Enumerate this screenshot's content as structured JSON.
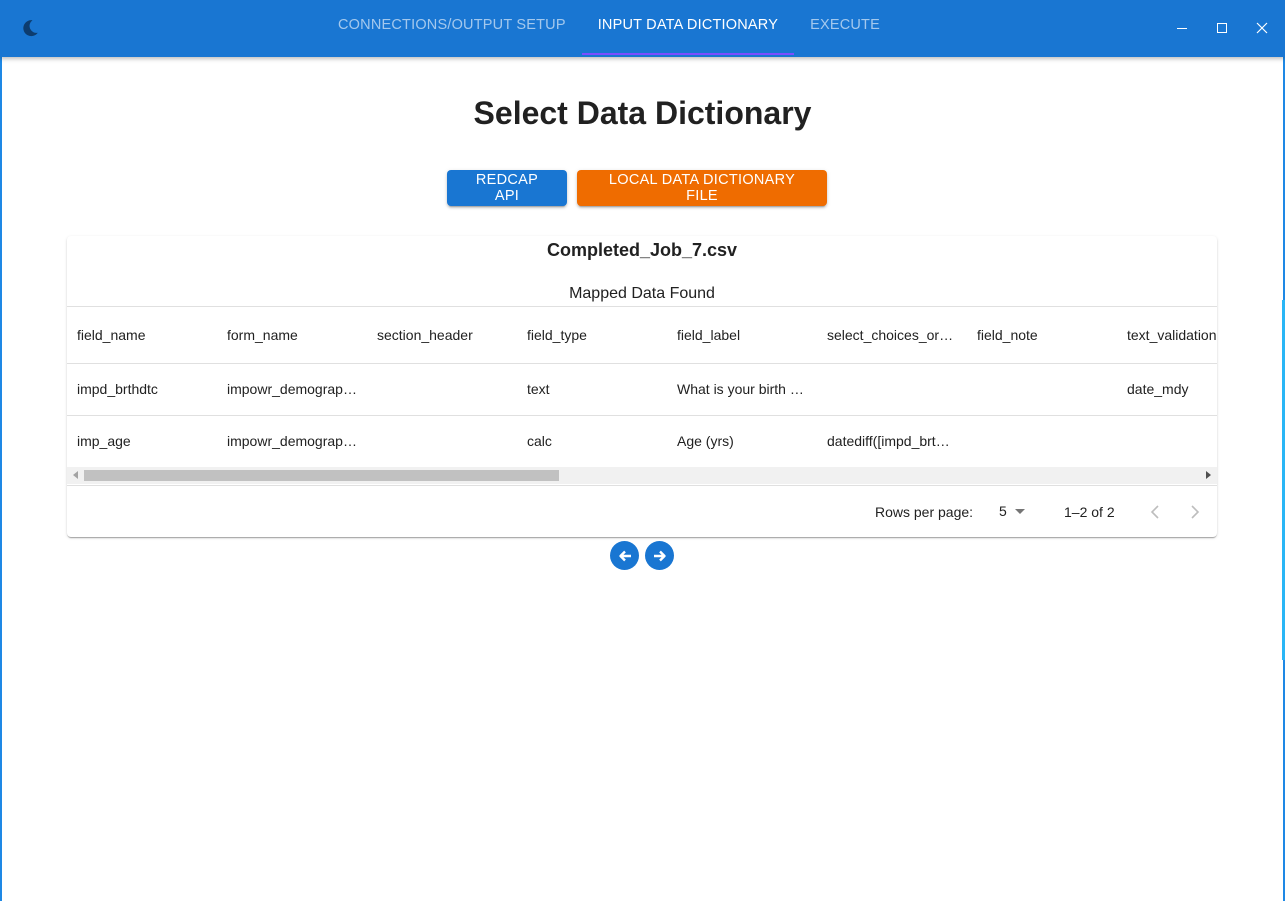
{
  "appbar": {
    "theme_icon": "moon-icon",
    "tabs": [
      {
        "label": "CONNECTIONS/OUTPUT SETUP",
        "active": false
      },
      {
        "label": "INPUT DATA DICTIONARY",
        "active": true
      },
      {
        "label": "EXECUTE",
        "active": false
      }
    ],
    "window_controls": [
      "minimize-icon",
      "maximize-icon",
      "close-icon"
    ]
  },
  "main": {
    "title": "Select Data Dictionary",
    "buttons": {
      "redcap": "REDCAP API",
      "local": "LOCAL DATA DICTIONARY FILE"
    }
  },
  "card": {
    "filename": "Completed_Job_7.csv",
    "subtitle": "Mapped Data Found",
    "columns": [
      "field_name",
      "form_name",
      "section_header",
      "field_type",
      "field_label",
      "select_choices_or_calculations",
      "field_note",
      "text_validation"
    ],
    "rows": [
      [
        "impd_brthdtc",
        "impowr_demographics",
        "",
        "text",
        "What is your birth date?",
        "",
        "",
        "date_mdy"
      ],
      [
        "imp_age",
        "impowr_demographics",
        "",
        "calc",
        "Age (yrs)",
        "datediff([impd_brthdtc]",
        "",
        ""
      ]
    ],
    "pagination": {
      "rows_per_page_label": "Rows per page:",
      "rows_per_page_value": "5",
      "range": "1–2 of 2"
    }
  },
  "nav": {
    "back_icon": "arrow-left-icon",
    "next_icon": "arrow-right-icon"
  },
  "colors": {
    "primary": "#1976d2",
    "accent_orange": "#ef6c00",
    "tab_indicator": "#7c4dff"
  }
}
